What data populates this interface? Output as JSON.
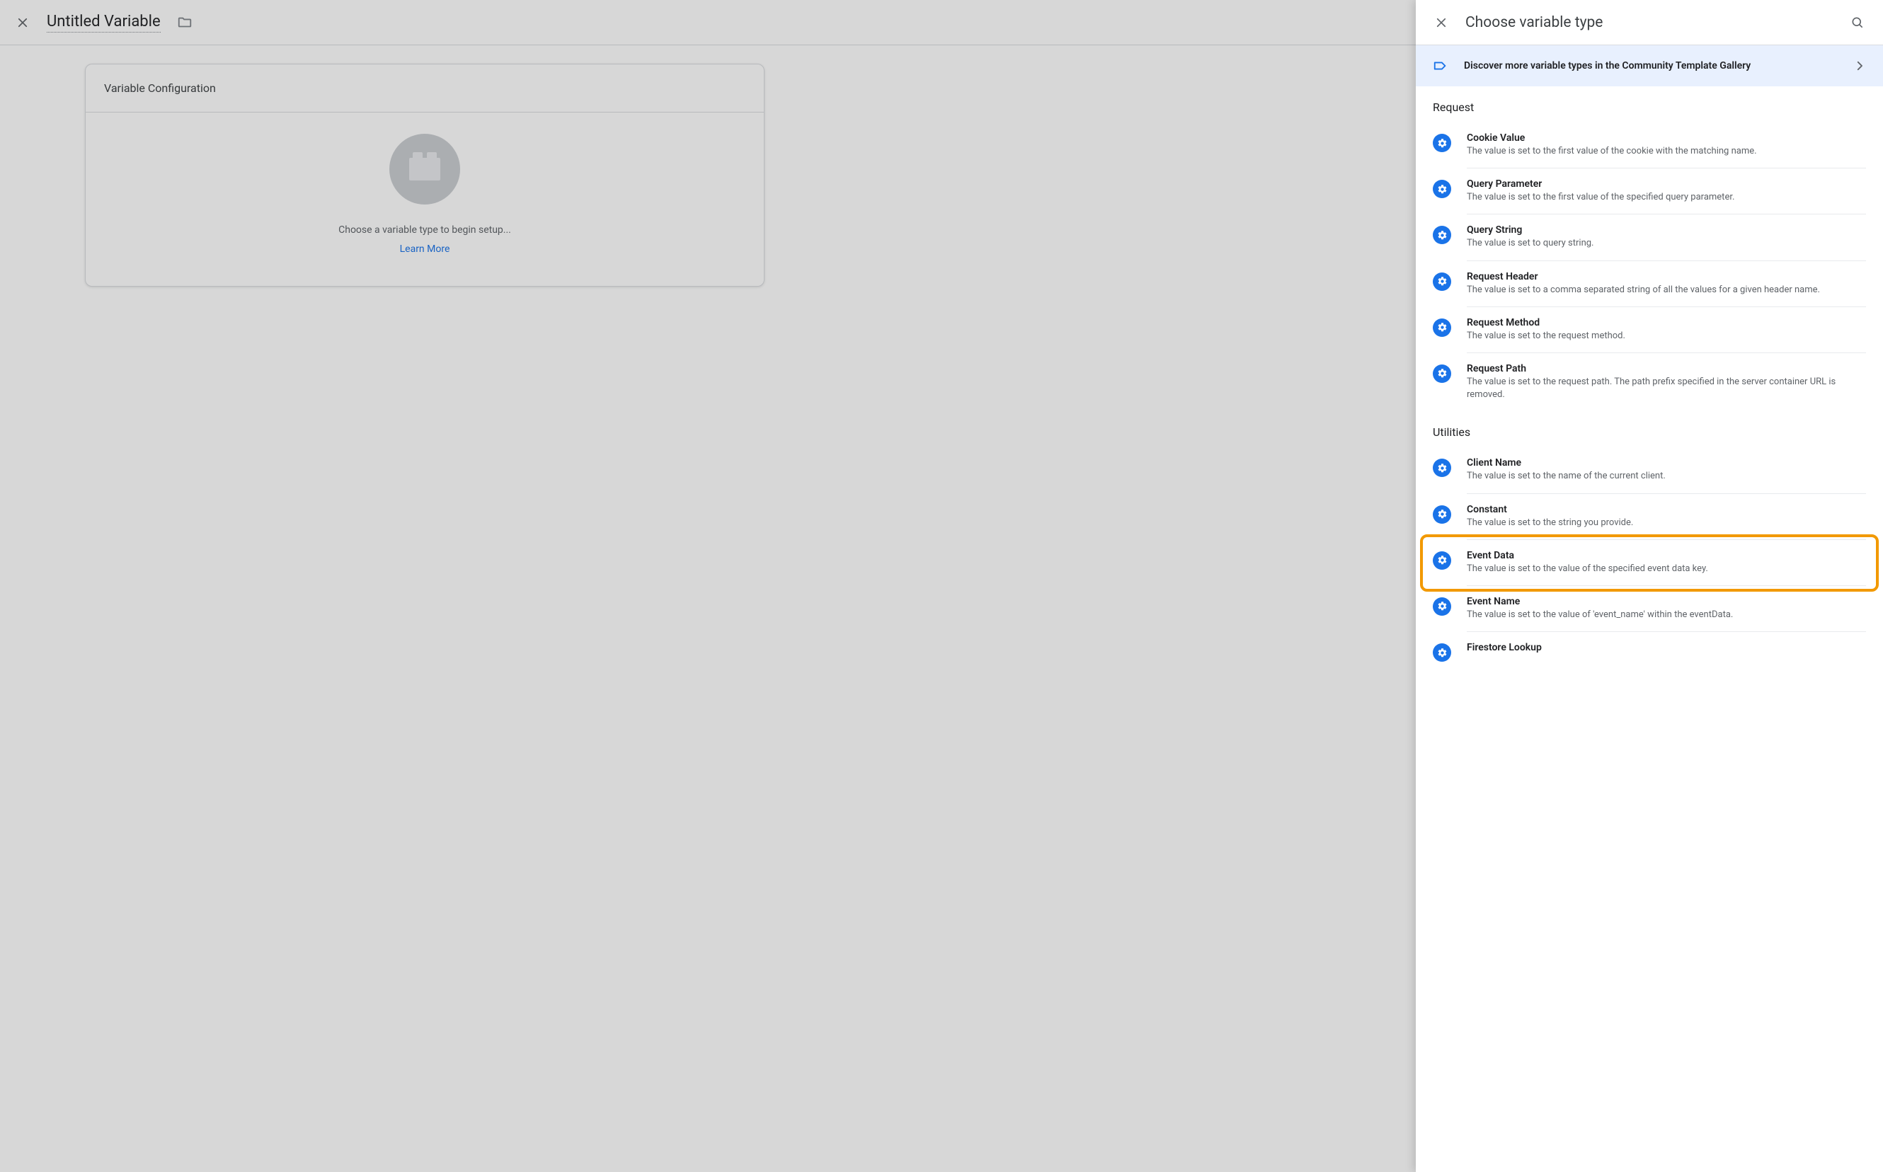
{
  "bg": {
    "title": "Untitled Variable",
    "card_header": "Variable Configuration",
    "prompt": "Choose a variable type to begin setup...",
    "learn_more": "Learn More"
  },
  "panel": {
    "title": "Choose variable type",
    "discover": "Discover more variable types in the Community Template Gallery"
  },
  "sections": [
    {
      "title": "Request",
      "items": [
        {
          "name": "Cookie Value",
          "desc": "The value is set to the first value of the cookie with the matching name."
        },
        {
          "name": "Query Parameter",
          "desc": "The value is set to the first value of the specified query parameter."
        },
        {
          "name": "Query String",
          "desc": "The value is set to query string."
        },
        {
          "name": "Request Header",
          "desc": "The value is set to a comma separated string of all the values for a given header name."
        },
        {
          "name": "Request Method",
          "desc": "The value is set to the request method."
        },
        {
          "name": "Request Path",
          "desc": "The value is set to the request path. The path prefix specified in the server container URL is removed."
        }
      ]
    },
    {
      "title": "Utilities",
      "items": [
        {
          "name": "Client Name",
          "desc": "The value is set to the name of the current client."
        },
        {
          "name": "Constant",
          "desc": "The value is set to the string you provide."
        },
        {
          "name": "Event Data",
          "desc": "The value is set to the value of the specified event data key.",
          "highlight": true
        },
        {
          "name": "Event Name",
          "desc": "The value is set to the value of 'event_name' within the eventData."
        },
        {
          "name": "Firestore Lookup",
          "desc": ""
        }
      ]
    }
  ]
}
